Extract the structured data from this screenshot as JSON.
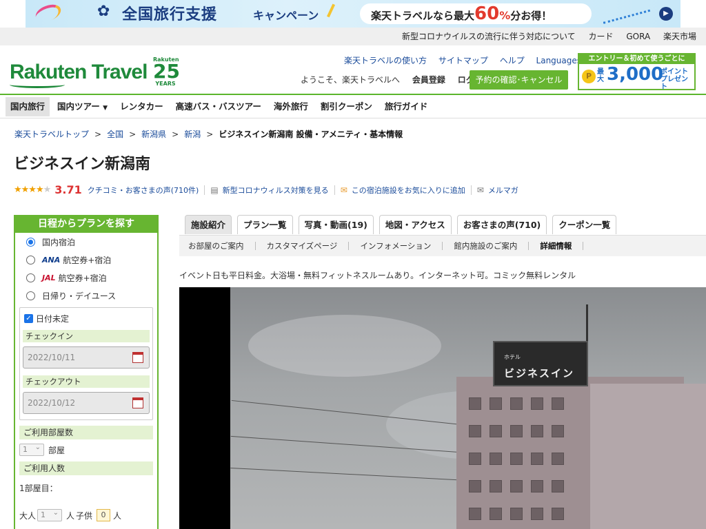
{
  "banner": {
    "title": "全国旅行支援",
    "subtitle": "キャンペーン",
    "pill_prefix": "楽天トラベルなら最大",
    "pill_big": "60",
    "pill_pct": "%",
    "pill_suffix": "分お得！"
  },
  "toplinks": [
    "新型コロナウイルスの流行に伴う対応について",
    "カード",
    "GORA",
    "楽天市場"
  ],
  "logo": {
    "text": "Rakuten Travel",
    "anniv_top": "Rakuten",
    "anniv_num": "25",
    "anniv_bottom": "YEARS"
  },
  "header": {
    "links": [
      "楽天トラベルの使い方",
      "サイトマップ",
      "ヘルプ"
    ],
    "languages": "Languages",
    "welcome": "ようこそ、楽天トラベルへ",
    "register": "会員登録",
    "login": "ログイン",
    "reserve_button": "予約の確認･キャンセル"
  },
  "promo": {
    "top": "エントリー＆初めて使うごとに",
    "coin": "P",
    "label": "最大",
    "amount": "3,000",
    "points": "ポイントプレゼント"
  },
  "gnav": [
    "国内旅行",
    "国内ツアー",
    "レンタカー",
    "高速バス・バスツアー",
    "海外旅行",
    "割引クーポン",
    "旅行ガイド"
  ],
  "breadcrumb": {
    "items": [
      "楽天トラベルトップ",
      "全国",
      "新潟県",
      "新潟"
    ],
    "current": "ビジネスイン新潟南 設備・アメニティ・基本情報",
    "separator": ">"
  },
  "hotel": {
    "name": "ビジネスイン新潟南",
    "rating": 3.71,
    "rating_text": "3.71",
    "reviews_link": "クチコミ・お客さまの声(710件)",
    "covid_link": "新型コロナウィルス対策を見る",
    "favorite_link": "この宿泊施設をお気に入りに追加",
    "mailmag_link": "メルマガ",
    "description": "イベント日も平日料金。大浴場・無料フィットネスルームあり。インターネット可。コミック無料レンタル"
  },
  "sidebar": {
    "title": "日程からプランを探す",
    "options": [
      {
        "label": "国内宿泊",
        "logo": "",
        "selected": true
      },
      {
        "label": "航空券+宿泊",
        "logo": "ANA",
        "selected": false
      },
      {
        "label": "航空券+宿泊",
        "logo": "JAL",
        "selected": false
      },
      {
        "label": "日帰り・デイユース",
        "logo": "",
        "selected": false
      }
    ],
    "undecided_label": "日付未定",
    "undecided_checked": true,
    "checkin_label": "チェックイン",
    "checkin_value": "2022/10/11",
    "checkout_label": "チェックアウト",
    "checkout_value": "2022/10/12",
    "rooms_label": "ご利用部屋数",
    "rooms_value": "1",
    "rooms_unit": "部屋",
    "people_label": "ご利用人数",
    "room1_label": "1部屋目：",
    "adult_label": "大人",
    "adult_value": "1",
    "person_unit": "人",
    "child_label": "子供",
    "child_value": "0"
  },
  "tabs": [
    "施設紹介",
    "プラン一覧",
    "写真・動画(19)",
    "地図・アクセス",
    "お客さまの声(710)",
    "クーポン一覧"
  ],
  "active_tab": 0,
  "subtabs": [
    "お部屋のご案内",
    "カスタマイズページ",
    "インフォメーション",
    "館内施設のご案内",
    "詳細情報"
  ],
  "active_subtab": 4,
  "photo": {
    "sign_small": "ホテル",
    "sign_big": "ビジネスイン"
  },
  "colors": {
    "brand_green": "#67b531",
    "link_blue": "#1a4b9a",
    "score_red": "#dd3333"
  }
}
